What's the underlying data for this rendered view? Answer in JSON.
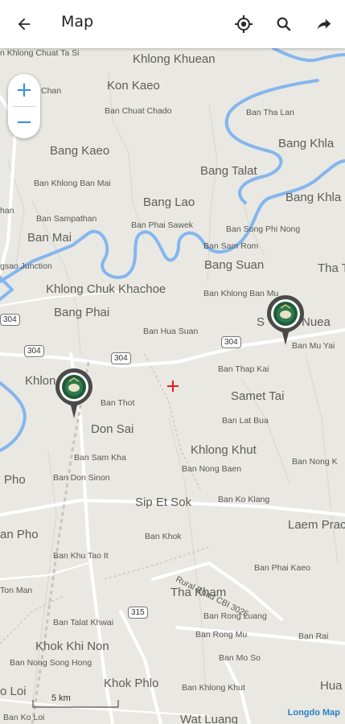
{
  "header": {
    "title": "Map",
    "back_icon": "arrow-left-icon",
    "actions": [
      "gps-fix-icon",
      "search-icon",
      "share-arrow-icon"
    ]
  },
  "zoom": {
    "in_label": "+",
    "out_label": "−"
  },
  "map": {
    "labels_big": [
      "Khlong Khuean",
      "Kon Kaeo",
      "Bang Kaeo",
      "Bang Khla",
      "Bang Talat",
      "Bang Lao",
      "Bang Khla",
      "Ban Mai",
      "Bang Suan",
      "Tha T",
      "Khlong Chuk Khachoe",
      "Bang Phai",
      "S",
      "Nuea",
      "Samet Tai",
      "Khlon",
      "Don Sai",
      "Khlong Khut",
      "Pho",
      "Sip Et Sok",
      "Laem Prac",
      "an Pho",
      "Tha Kham",
      "Khok Khi Non",
      "Khok Phlo",
      "Hua",
      "o Loi",
      "Wat Luang"
    ],
    "labels_small": [
      "n Khlong Chuat Ta Si",
      "Chan",
      "Ban Chuat Chado",
      "Ban Tha Lan",
      "Ban Khlong Ban Mai",
      "han",
      "Ban Sampathan",
      "Ban Phai Sawek",
      "Ban Song Phi Nong",
      "Ban Sam Rom",
      "gsao Junction",
      "Ban Khlong Ban Mu",
      "Ban Hua Suan",
      "Ban Mu Yai",
      "Ban Thap Kai",
      "Ban Thot",
      "Ban Lat Bua",
      "Ban Sam Kha",
      "Ban Nong Baen",
      "Ban Nong K",
      "Ban Don Sinon",
      "Ban Ko Klang",
      "Ban Khok",
      "Ban Khu Tao It",
      "Ban Phai Kaeo",
      "Rural Road CBI 3025",
      "Ton Man",
      "Ban Rong Luang",
      "Ban Talat Khwai",
      "Ban Rong Mu",
      "Ban Rai",
      "Ban Mo So",
      "Ban Nong Song Hong",
      "Ban Khlong Khut",
      "Ban Ko Loi"
    ],
    "road_shields": [
      "304",
      "304",
      "304",
      "304",
      "315"
    ],
    "scale_label": "5 km",
    "brand": "Longdo Map",
    "center_marker_icon": "crosshair-plus-icon",
    "pins": [
      "poi-pin-1",
      "poi-pin-2"
    ]
  },
  "colors": {
    "water": "#84b6ef",
    "land": "#e9e8e3",
    "road": "#ffffff",
    "pin": "#4a4a4a",
    "brand": "#2c7fc4"
  }
}
